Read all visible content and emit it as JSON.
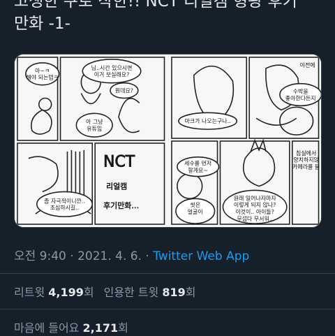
{
  "tweet": {
    "text_line1": "고생한 쿠로 작한!! NCT 리얼캠 형광 후기",
    "text_line2": "만화 -1-"
  },
  "comic": {
    "left": {
      "bubble1": "아~ㅋ\n해야 되는뎁ㅋ",
      "bubble2": "님..시간 있으시면\n이거 보실래요?",
      "bubble3": "뭔데요?",
      "bubble4": "아 그냥\n유튜임",
      "bubble5": "좀 자극적이니깐..\n조심하시길..",
      "title_word": "NCT",
      "subtitle1": "리얼캠",
      "subtitle2": "후기만화…"
    },
    "right": {
      "bubble1": "마크가 나오는구나..",
      "bubble2": "수박을\n좋아한다든지",
      "bubble3": "이전에 같이\n안 있어\n그에",
      "bubble4": "세수를 먼저\n할게요~",
      "bubble5": "씻은\n얼굴이\n아니었어?",
      "bubble6": "원래 일어나자마자\n이렇게 되지 않나?\n이것이.. 아이돌?\n무섭다 무서워..",
      "bubble7": "침실에서\n양치하지않\n카메라를 들\n화장실에 가\n안되나.."
    }
  },
  "meta": {
    "time": "오전 9:40",
    "sep1": " · ",
    "date": "2021. 4. 6.",
    "sep2": " · ",
    "app": "Twitter Web App"
  },
  "stats": {
    "retweets_label": "리트윗",
    "retweets_count": "4,199",
    "retweets_unit": "회",
    "quotes_label": "인용한 트윗",
    "quotes_count": "819",
    "quotes_unit": "회",
    "likes_label": "마음에 들어요",
    "likes_count": "2,171",
    "likes_unit": "회"
  }
}
